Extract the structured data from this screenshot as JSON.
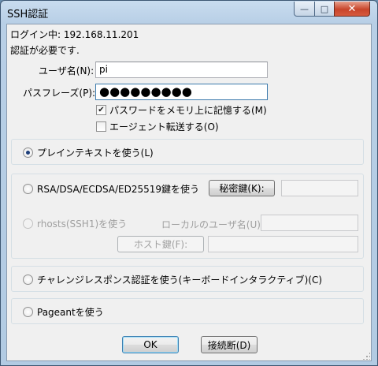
{
  "window": {
    "title": "SSH認証",
    "minimize_glyph": "—",
    "maximize_glyph": "□",
    "close_glyph": "✕"
  },
  "header": {
    "login_line": "ログイン中: 192.168.11.201",
    "auth_required": "認証が必要です."
  },
  "form": {
    "username_label": "ユーザ名(N):",
    "username_value": "pi",
    "passphrase_label": "パスフレーズ(P):",
    "passphrase_mask": "●●●●●●●●●",
    "remember_label": "パスワードをメモリ上に記憶する(M)",
    "remember_checked": true,
    "agent_forward_label": "エージェント転送する(O)",
    "agent_forward_checked": false
  },
  "methods": {
    "plaintext": {
      "label": "プレインテキストを使う(L)",
      "selected": true
    },
    "rsa": {
      "label": "RSA/DSA/ECDSA/ED25519鍵を使う",
      "selected": false,
      "key_button": "秘密鍵(K):",
      "key_path": ""
    },
    "rhosts": {
      "label": "rhosts(SSH1)を使う",
      "selected": false,
      "enabled": false,
      "local_user_label": "ローカルのユーザ名(U):",
      "local_user_value": "",
      "host_key_button": "ホスト鍵(F):",
      "host_key_path": ""
    },
    "challenge": {
      "label": "チャレンジレスポンス認証を使う(キーボードインタラクティブ)(C)",
      "selected": false
    },
    "pageant": {
      "label": "Pageantを使う",
      "selected": false
    }
  },
  "buttons": {
    "ok": "OK",
    "disconnect": "接続断(D)"
  },
  "colors": {
    "title_bar": "#b8cfe6",
    "client_bg": "#f0f0f0",
    "close_button": "#c8452b",
    "radio_dot": "#1e3f7a"
  }
}
